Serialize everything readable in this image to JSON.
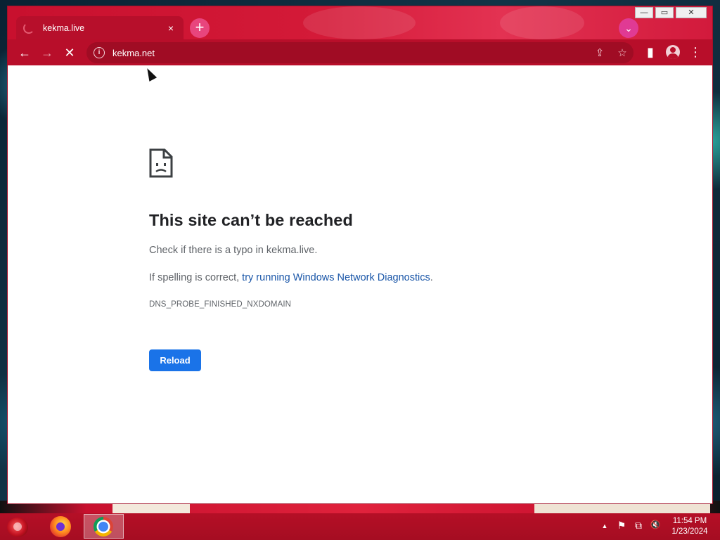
{
  "browser": {
    "tab": {
      "title": "kekma.live",
      "close_icon": "×",
      "loading": true
    },
    "new_tab_symbol": "+",
    "tab_search_symbol": "⌄",
    "window_controls": {
      "minimize": "—",
      "maximize": "▭",
      "close": "✕"
    },
    "toolbar": {
      "back": "←",
      "forward": "→",
      "stop": "✕",
      "info": "i",
      "url": "kekma.net",
      "share": "⇪",
      "bookmark": "☆",
      "side_panel": "▮",
      "menu": "⋮"
    },
    "theme": {
      "frame": "#c8102e",
      "toolbar": "#b80e2a",
      "omnibox": "#a00c24"
    }
  },
  "page": {
    "heading": "This site can’t be reached",
    "line1": "Check if there is a typo in kekma.live.",
    "line2_prefix": "If spelling is correct, ",
    "line2_link": "try running Windows Network Diagnostics",
    "line2_suffix": ".",
    "error_code": "DNS_PROBE_FINISHED_NXDOMAIN",
    "reload_label": "Reload",
    "accent": "#1a73e8",
    "link_color": "#1a56a8"
  },
  "taskbar": {
    "apps": [
      "firefox",
      "chrome"
    ],
    "active_app": "chrome",
    "tray": {
      "show_hidden": "▲",
      "flag": "⚑",
      "network": "⧉",
      "volume": "🔇"
    },
    "time": "11:54 PM",
    "date": "1/23/2024"
  }
}
